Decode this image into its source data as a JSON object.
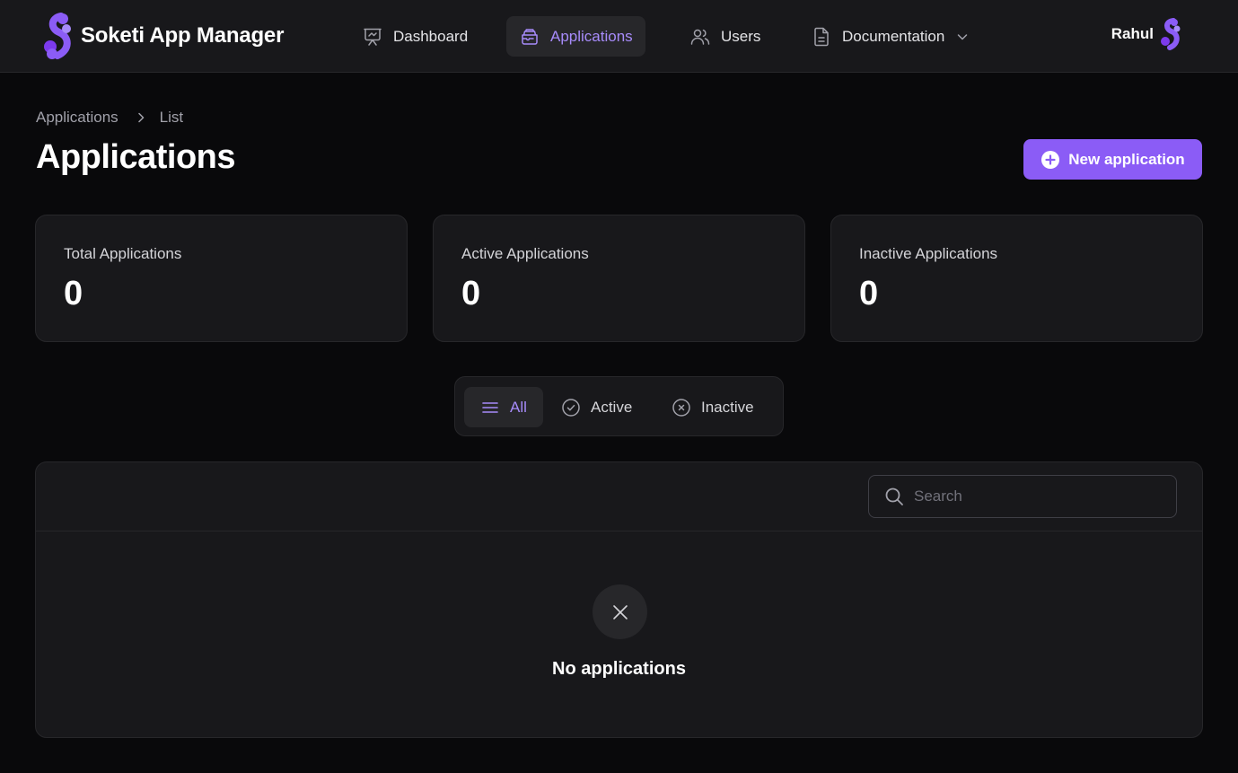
{
  "app": {
    "name": "Soketi App Manager"
  },
  "nav": {
    "items": [
      {
        "label": "Dashboard",
        "icon": "chart-presentation-icon"
      },
      {
        "label": "Applications",
        "icon": "inbox-stack-icon",
        "active": true
      },
      {
        "label": "Users",
        "icon": "users-icon"
      },
      {
        "label": "Documentation",
        "icon": "document-icon",
        "has_dropdown": true
      }
    ],
    "user": {
      "name": "Rahul"
    }
  },
  "breadcrumb": {
    "parent": "Applications",
    "current": "List"
  },
  "page": {
    "title": "Applications",
    "new_button_label": "New application"
  },
  "stats": [
    {
      "label": "Total Applications",
      "value": "0"
    },
    {
      "label": "Active Applications",
      "value": "0"
    },
    {
      "label": "Inactive Applications",
      "value": "0"
    }
  ],
  "filters": {
    "tabs": [
      {
        "label": "All",
        "icon": "bars-icon",
        "active": true
      },
      {
        "label": "Active",
        "icon": "check-circle-icon"
      },
      {
        "label": "Inactive",
        "icon": "x-circle-icon"
      }
    ]
  },
  "table": {
    "search_placeholder": "Search",
    "empty_message": "No applications"
  },
  "colors": {
    "accent": "#8b5cf6",
    "accent_text": "#a78bfa",
    "background": "#09090b",
    "surface": "#18181b",
    "border": "#27272a"
  }
}
